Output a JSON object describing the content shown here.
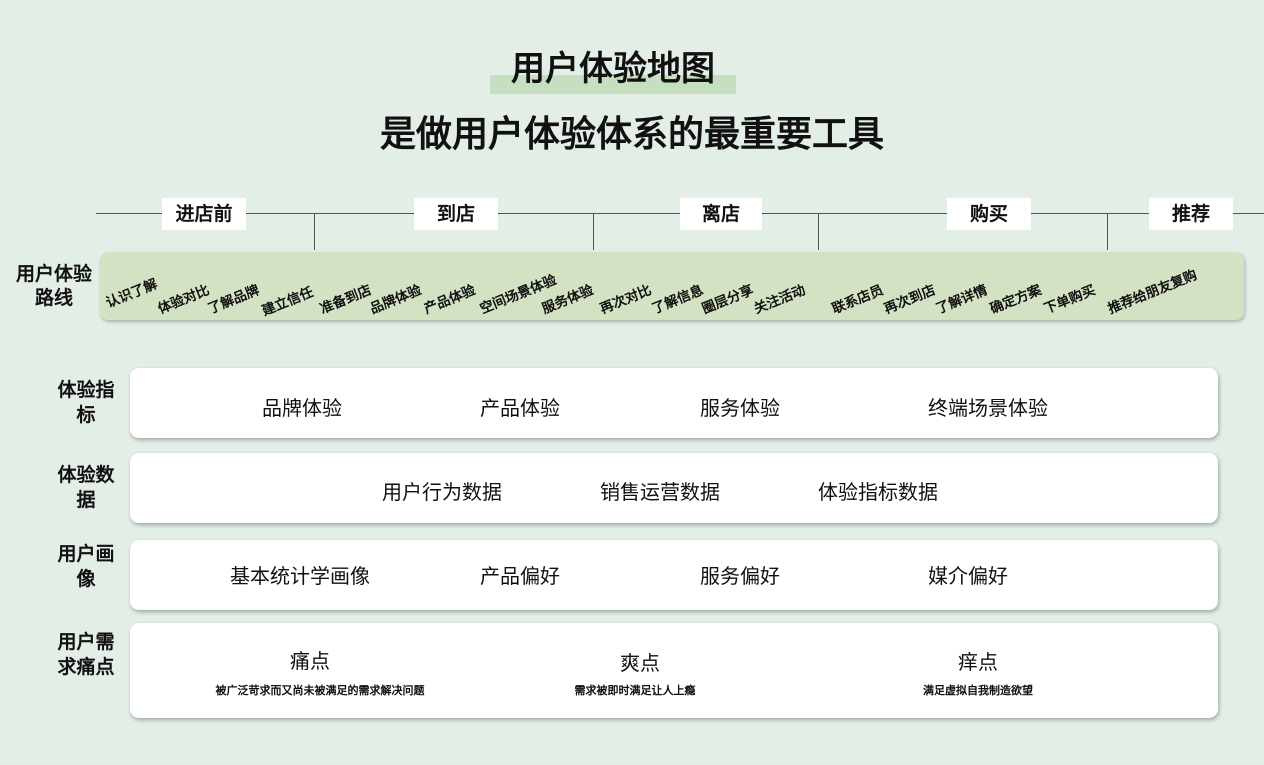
{
  "title": {
    "line1": "用户体验地图",
    "line2": "是做用户体验体系的最重要工具"
  },
  "stages": [
    "进店前",
    "到店",
    "离店",
    "购买",
    "推荐"
  ],
  "route": {
    "label": "用户体验路线",
    "steps": [
      "认识了解",
      "体验对比",
      "了解品牌",
      "建立信任",
      "准备到店",
      "品牌体验",
      "产品体验",
      "空间场景体验",
      "服务体验",
      "再次对比",
      "了解信息",
      "圈层分享",
      "关注活动",
      "联系店员",
      "再次到店",
      "了解详情",
      "确定方案",
      "下单购买",
      "推荐给朋友复购"
    ]
  },
  "rows": {
    "metrics": {
      "label": "体验指标",
      "items": [
        "品牌体验",
        "产品体验",
        "服务体验",
        "终端场景体验"
      ]
    },
    "data": {
      "label": "体验数据",
      "items": [
        "用户行为数据",
        "销售运营数据",
        "体验指标数据"
      ]
    },
    "persona": {
      "label": "用户画像",
      "items": [
        "基本统计学画像",
        "产品偏好",
        "服务偏好",
        "媒介偏好"
      ]
    },
    "needs": {
      "label": "用户需求痛点",
      "items": [
        {
          "title": "痛点",
          "desc": "被广泛苛求而又尚未被满足的需求解决问题"
        },
        {
          "title": "爽点",
          "desc": "需求被即时满足让人上瘾"
        },
        {
          "title": "痒点",
          "desc": "满足虚拟自我制造欲望"
        }
      ]
    }
  }
}
